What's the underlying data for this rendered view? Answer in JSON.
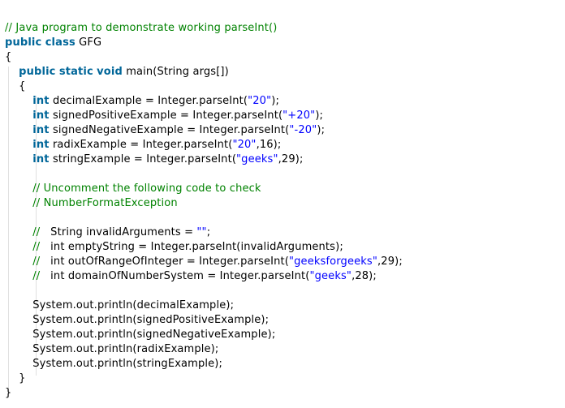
{
  "colors": {
    "background": "#ffffff",
    "plain": "#000000",
    "comment": "#008200",
    "keyword": "#006699",
    "string": "#0000ff"
  },
  "code": {
    "lines": [
      [
        {
          "t": "c",
          "v": "// Java program to demonstrate working parseInt()"
        }
      ],
      [
        {
          "t": "k",
          "v": "public"
        },
        {
          "t": "p",
          "v": " "
        },
        {
          "t": "k",
          "v": "class"
        },
        {
          "t": "p",
          "v": " GFG"
        }
      ],
      [
        {
          "t": "p",
          "v": "{"
        }
      ],
      [
        {
          "t": "p",
          "v": "    "
        },
        {
          "t": "k",
          "v": "public"
        },
        {
          "t": "p",
          "v": " "
        },
        {
          "t": "k",
          "v": "static"
        },
        {
          "t": "p",
          "v": " "
        },
        {
          "t": "k",
          "v": "void"
        },
        {
          "t": "p",
          "v": " main(String args[])"
        }
      ],
      [
        {
          "t": "p",
          "v": "    {"
        }
      ],
      [
        {
          "t": "p",
          "v": "        "
        },
        {
          "t": "k",
          "v": "int"
        },
        {
          "t": "p",
          "v": " decimalExample = Integer.parseInt("
        },
        {
          "t": "s",
          "v": "\"20\""
        },
        {
          "t": "p",
          "v": ");"
        }
      ],
      [
        {
          "t": "p",
          "v": "        "
        },
        {
          "t": "k",
          "v": "int"
        },
        {
          "t": "p",
          "v": " signedPositiveExample = Integer.parseInt("
        },
        {
          "t": "s",
          "v": "\"+20\""
        },
        {
          "t": "p",
          "v": ");"
        }
      ],
      [
        {
          "t": "p",
          "v": "        "
        },
        {
          "t": "k",
          "v": "int"
        },
        {
          "t": "p",
          "v": " signedNegativeExample = Integer.parseInt("
        },
        {
          "t": "s",
          "v": "\"-20\""
        },
        {
          "t": "p",
          "v": ");"
        }
      ],
      [
        {
          "t": "p",
          "v": "        "
        },
        {
          "t": "k",
          "v": "int"
        },
        {
          "t": "p",
          "v": " radixExample = Integer.parseInt("
        },
        {
          "t": "s",
          "v": "\"20\""
        },
        {
          "t": "p",
          "v": ",16);"
        }
      ],
      [
        {
          "t": "p",
          "v": "        "
        },
        {
          "t": "k",
          "v": "int"
        },
        {
          "t": "p",
          "v": " stringExample = Integer.parseInt("
        },
        {
          "t": "s",
          "v": "\"geeks\""
        },
        {
          "t": "p",
          "v": ",29);"
        }
      ],
      [],
      [
        {
          "t": "p",
          "v": "        "
        },
        {
          "t": "c",
          "v": "// Uncomment the following code to check"
        }
      ],
      [
        {
          "t": "p",
          "v": "        "
        },
        {
          "t": "c",
          "v": "// NumberFormatException"
        }
      ],
      [],
      [
        {
          "t": "p",
          "v": "        "
        },
        {
          "t": "c",
          "v": "//"
        },
        {
          "t": "p",
          "v": "   String invalidArguments = "
        },
        {
          "t": "s",
          "v": "\"\""
        },
        {
          "t": "p",
          "v": ";"
        }
      ],
      [
        {
          "t": "p",
          "v": "        "
        },
        {
          "t": "c",
          "v": "//"
        },
        {
          "t": "p",
          "v": "   int emptyString = Integer.parseInt(invalidArguments);"
        }
      ],
      [
        {
          "t": "p",
          "v": "        "
        },
        {
          "t": "c",
          "v": "//"
        },
        {
          "t": "p",
          "v": "   int outOfRangeOfInteger = Integer.parseInt("
        },
        {
          "t": "s",
          "v": "\"geeksforgeeks\""
        },
        {
          "t": "p",
          "v": ",29);"
        }
      ],
      [
        {
          "t": "p",
          "v": "        "
        },
        {
          "t": "c",
          "v": "//"
        },
        {
          "t": "p",
          "v": "   int domainOfNumberSystem = Integer.parseInt("
        },
        {
          "t": "s",
          "v": "\"geeks\""
        },
        {
          "t": "p",
          "v": ",28);"
        }
      ],
      [],
      [
        {
          "t": "p",
          "v": "        System.out.println(decimalExample);"
        }
      ],
      [
        {
          "t": "p",
          "v": "        System.out.println(signedPositiveExample);"
        }
      ],
      [
        {
          "t": "p",
          "v": "        System.out.println(signedNegativeExample);"
        }
      ],
      [
        {
          "t": "p",
          "v": "        System.out.println(radixExample);"
        }
      ],
      [
        {
          "t": "p",
          "v": "        System.out.println(stringExample);"
        }
      ],
      [
        {
          "t": "p",
          "v": "    }"
        }
      ],
      [
        {
          "t": "p",
          "v": "}"
        }
      ]
    ]
  }
}
